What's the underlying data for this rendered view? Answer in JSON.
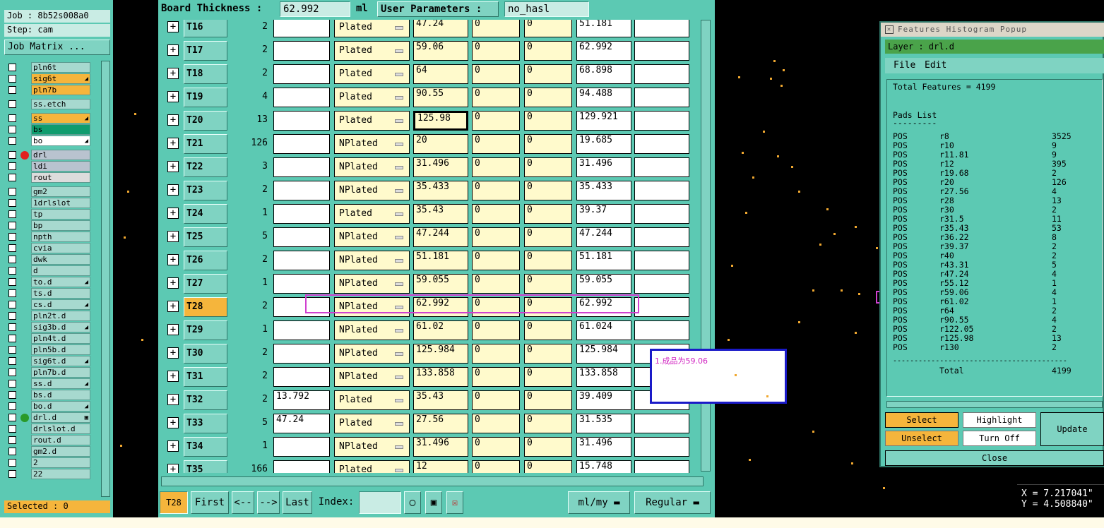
{
  "left_panel": {
    "job": "Job : 8b52s008a0",
    "step": "Step: cam",
    "job_matrix_button": "Job Matrix ...",
    "selected": "Selected : 0",
    "layers": [
      {
        "name": "pln6t",
        "color": "#a7d9cf"
      },
      {
        "name": "sig6t",
        "color": "#f5b53c",
        "mark": "◢"
      },
      {
        "name": "pln7b",
        "color": "#f5b53c"
      },
      {
        "name": "ss.etch",
        "color": "#a7d9cf"
      },
      {
        "name": "ss",
        "color": "#f5b53c",
        "mark": "◢"
      },
      {
        "name": "bs",
        "color": "#0f9c6e"
      },
      {
        "name": "bo",
        "color": "#ffffff",
        "mark": "◢"
      },
      {
        "name": "drl",
        "color": "#b9c3cf",
        "dot": "#e02020"
      },
      {
        "name": "ldi",
        "color": "#b9c3cf"
      },
      {
        "name": "rout",
        "color": "#dcdcdc"
      },
      {
        "name": "gm2",
        "color": "#a7d9cf"
      },
      {
        "name": "1drlslot",
        "color": "#a7d9cf"
      },
      {
        "name": "tp",
        "color": "#a7d9cf"
      },
      {
        "name": "bp",
        "color": "#a7d9cf"
      },
      {
        "name": "npth",
        "color": "#a7d9cf"
      },
      {
        "name": "cvia",
        "color": "#a7d9cf"
      },
      {
        "name": "dwk",
        "color": "#a7d9cf"
      },
      {
        "name": "d",
        "color": "#a7d9cf"
      },
      {
        "name": "to.d",
        "color": "#a7d9cf",
        "mark": "◢"
      },
      {
        "name": "ts.d",
        "color": "#a7d9cf"
      },
      {
        "name": "cs.d",
        "color": "#a7d9cf",
        "mark": "◢"
      },
      {
        "name": "pln2t.d",
        "color": "#a7d9cf"
      },
      {
        "name": "sig3b.d",
        "color": "#a7d9cf",
        "mark": "◢"
      },
      {
        "name": "pln4t.d",
        "color": "#a7d9cf"
      },
      {
        "name": "pln5b.d",
        "color": "#a7d9cf"
      },
      {
        "name": "sig6t.d",
        "color": "#a7d9cf",
        "mark": "◢"
      },
      {
        "name": "pln7b.d",
        "color": "#a7d9cf"
      },
      {
        "name": "ss.d",
        "color": "#a7d9cf",
        "mark": "◢"
      },
      {
        "name": "bs.d",
        "color": "#a7d9cf"
      },
      {
        "name": "bo.d",
        "color": "#a7d9cf",
        "mark": "◢"
      },
      {
        "name": "drl.d",
        "color": "#a7d9cf",
        "dot": "#2a9a2a",
        "mark": "▣"
      },
      {
        "name": "drlslot.d",
        "color": "#a7d9cf"
      },
      {
        "name": "rout.d",
        "color": "#a7d9cf"
      },
      {
        "name": "gm2.d",
        "color": "#a7d9cf"
      },
      {
        "name": "2",
        "color": "#a7d9cf"
      },
      {
        "name": "22",
        "color": "#a7d9cf"
      }
    ]
  },
  "header": {
    "board_thickness_label": "Board Thickness :",
    "board_thickness_value": "62.992",
    "board_thickness_unit": "ml",
    "user_parameters_label": "User Parameters :",
    "user_parameters_value": "no_hasl"
  },
  "tools": [
    {
      "tool": "T16",
      "count": "2",
      "in1": "",
      "type": "Plated",
      "finish": "47.24",
      "plus": "0",
      "minus": "0",
      "drill": "51.181"
    },
    {
      "tool": "T17",
      "count": "2",
      "in1": "",
      "type": "Plated",
      "finish": "59.06",
      "plus": "0",
      "minus": "0",
      "drill": "62.992"
    },
    {
      "tool": "T18",
      "count": "2",
      "in1": "",
      "type": "Plated",
      "finish": "64",
      "plus": "0",
      "minus": "0",
      "drill": "68.898"
    },
    {
      "tool": "T19",
      "count": "4",
      "in1": "",
      "type": "Plated",
      "finish": "90.55",
      "plus": "0",
      "minus": "0",
      "drill": "94.488"
    },
    {
      "tool": "T20",
      "count": "13",
      "in1": "",
      "type": "Plated",
      "finish": "125.98",
      "plus": "0",
      "minus": "0",
      "drill": "129.921"
    },
    {
      "tool": "T21",
      "count": "126",
      "in1": "",
      "type": "NPlated",
      "finish": "20",
      "plus": "0",
      "minus": "0",
      "drill": "19.685"
    },
    {
      "tool": "T22",
      "count": "3",
      "in1": "",
      "type": "NPlated",
      "finish": "31.496",
      "plus": "0",
      "minus": "0",
      "drill": "31.496"
    },
    {
      "tool": "T23",
      "count": "2",
      "in1": "",
      "type": "NPlated",
      "finish": "35.433",
      "plus": "0",
      "minus": "0",
      "drill": "35.433"
    },
    {
      "tool": "T24",
      "count": "1",
      "in1": "",
      "type": "Plated",
      "finish": "35.43",
      "plus": "0",
      "minus": "0",
      "drill": "39.37"
    },
    {
      "tool": "T25",
      "count": "5",
      "in1": "",
      "type": "NPlated",
      "finish": "47.244",
      "plus": "0",
      "minus": "0",
      "drill": "47.244"
    },
    {
      "tool": "T26",
      "count": "2",
      "in1": "",
      "type": "NPlated",
      "finish": "51.181",
      "plus": "0",
      "minus": "0",
      "drill": "51.181"
    },
    {
      "tool": "T27",
      "count": "1",
      "in1": "",
      "type": "NPlated",
      "finish": "59.055",
      "plus": "0",
      "minus": "0",
      "drill": "59.055"
    },
    {
      "tool": "T28",
      "count": "2",
      "in1": "",
      "type": "NPlated",
      "finish": "62.992",
      "plus": "0",
      "minus": "0",
      "drill": "62.992"
    },
    {
      "tool": "T29",
      "count": "1",
      "in1": "",
      "type": "NPlated",
      "finish": "61.02",
      "plus": "0",
      "minus": "0",
      "drill": "61.024"
    },
    {
      "tool": "T30",
      "count": "2",
      "in1": "",
      "type": "NPlated",
      "finish": "125.984",
      "plus": "0",
      "minus": "0",
      "drill": "125.984"
    },
    {
      "tool": "T31",
      "count": "2",
      "in1": "",
      "type": "NPlated",
      "finish": "133.858",
      "plus": "0",
      "minus": "0",
      "drill": "133.858"
    },
    {
      "tool": "T32",
      "count": "2",
      "in1": "13.792",
      "type": "Plated",
      "finish": "35.43",
      "plus": "0",
      "minus": "0",
      "drill": "39.409"
    },
    {
      "tool": "T33",
      "count": "5",
      "in1": "47.24",
      "type": "Plated",
      "finish": "27.56",
      "plus": "0",
      "minus": "0",
      "drill": "31.535"
    },
    {
      "tool": "T34",
      "count": "1",
      "in1": "",
      "type": "NPlated",
      "finish": "31.496",
      "plus": "0",
      "minus": "0",
      "drill": "31.496"
    },
    {
      "tool": "T35",
      "count": "166",
      "in1": "",
      "type": "Plated",
      "finish": "12",
      "plus": "0",
      "minus": "0",
      "drill": "15.748"
    }
  ],
  "bottom_bar": {
    "current_tool": "T28",
    "first": "First",
    "prev": "<--",
    "next": "-->",
    "last": "Last",
    "index_label": "Index:",
    "index_value": "",
    "units": "ml/my",
    "mode": "Regular"
  },
  "note": "1.成品为59.06",
  "popup": {
    "title": "Features Histogram Popup",
    "layer": "Layer :  drl.d",
    "menu_file": "File",
    "menu_edit": "Edit",
    "total_features": "Total Features = 4199",
    "pads_list": "Pads List",
    "pads_underline": "---------",
    "pads": [
      {
        "pol": "POS",
        "sym": "r8",
        "count": "3525"
      },
      {
        "pol": "POS",
        "sym": "r10",
        "count": "9"
      },
      {
        "pol": "POS",
        "sym": "r11.81",
        "count": "9"
      },
      {
        "pol": "POS",
        "sym": "r12",
        "count": "395"
      },
      {
        "pol": "POS",
        "sym": "r19.68",
        "count": "2"
      },
      {
        "pol": "POS",
        "sym": "r20",
        "count": "126"
      },
      {
        "pol": "POS",
        "sym": "r27.56",
        "count": "4"
      },
      {
        "pol": "POS",
        "sym": "r28",
        "count": "13"
      },
      {
        "pol": "POS",
        "sym": "r30",
        "count": "2"
      },
      {
        "pol": "POS",
        "sym": "r31.5",
        "count": "11"
      },
      {
        "pol": "POS",
        "sym": "r35.43",
        "count": "53"
      },
      {
        "pol": "POS",
        "sym": "r36.22",
        "count": "8"
      },
      {
        "pol": "POS",
        "sym": "r39.37",
        "count": "2"
      },
      {
        "pol": "POS",
        "sym": "r40",
        "count": "2"
      },
      {
        "pol": "POS",
        "sym": "r43.31",
        "count": "5"
      },
      {
        "pol": "POS",
        "sym": "r47.24",
        "count": "4"
      },
      {
        "pol": "POS",
        "sym": "r55.12",
        "count": "1"
      },
      {
        "pol": "POS",
        "sym": "r59.06",
        "count": "4"
      },
      {
        "pol": "POS",
        "sym": "r61.02",
        "count": "1"
      },
      {
        "pol": "POS",
        "sym": "r64",
        "count": "2"
      },
      {
        "pol": "POS",
        "sym": "r90.55",
        "count": "4"
      },
      {
        "pol": "POS",
        "sym": "r122.05",
        "count": "2"
      },
      {
        "pol": "POS",
        "sym": "r125.98",
        "count": "13"
      },
      {
        "pol": "POS",
        "sym": "r130",
        "count": "2"
      }
    ],
    "separator": "-----------------------------------------",
    "total_label": "Total",
    "total_value": "4199",
    "select": "Select",
    "highlight": "Highlight",
    "unselect": "Unselect",
    "turn_off": "Turn Off",
    "update": "Update",
    "close": "Close"
  },
  "coords": {
    "x": "X = 7.217041\"",
    "y": "Y = 4.508840\""
  },
  "colors": {
    "panel": "#5cc9b3",
    "highlight": "#f5b53c",
    "annotation": "#d040d0",
    "note_border": "#1a1ac8"
  }
}
